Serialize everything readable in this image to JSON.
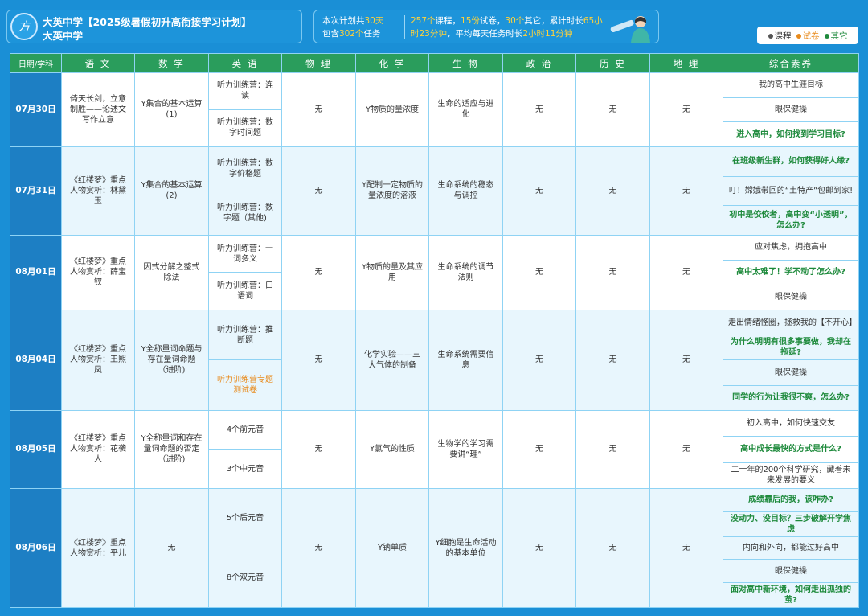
{
  "header": {
    "logo_glyph": "方",
    "title": "大英中学【2025级暑假初升高衔接学习计划】",
    "subtitle": "大英中学",
    "stats": {
      "plan_prefix": "本次计划共",
      "plan_days": "30天",
      "tasks_prefix": "包含",
      "tasks_count": "302个",
      "tasks_suffix": "任务",
      "courses": "257个",
      "courses_suffix": "课程，",
      "papers": "15份",
      "papers_suffix": "试卷，",
      "others": "30个",
      "others_suffix": "其它，累计时长",
      "total_time": "65小时23分钟",
      "avg_prefix": "，平均每天任务时长",
      "avg_time": "2小时11分钟"
    },
    "legend": [
      {
        "label": "课程",
        "color": "#555555"
      },
      {
        "label": "试卷",
        "color": "#e88a1a"
      },
      {
        "label": "其它",
        "color": "#1e8a3c"
      }
    ]
  },
  "columns": [
    "日期/学科",
    "语 文",
    "数 学",
    "英 语",
    "物 理",
    "化 学",
    "生 物",
    "政 治",
    "历 史",
    "地 理",
    "综合素养"
  ],
  "days": [
    {
      "date": "07月30日",
      "chinese": "倚天长剑，立意制胜——论述文写作立意",
      "math": "Y集合的基本运算(1)",
      "english": [
        {
          "text": "听力训练营：连读",
          "type": "course"
        },
        {
          "text": "听力训练营：数字时间题",
          "type": "course"
        }
      ],
      "physics": "无",
      "chemistry": "Y物质的量浓度",
      "biology": "生命的适应与进化",
      "politics": "无",
      "history": "无",
      "geography": "无",
      "quality": [
        {
          "text": "我的高中生涯目标",
          "type": "course"
        },
        {
          "text": "眼保健操",
          "type": "course"
        },
        {
          "text": "进入高中，如何找到学习目标?",
          "type": "other"
        }
      ]
    },
    {
      "date": "07月31日",
      "chinese": "《红楼梦》重点人物赏析：林黛玉",
      "math": "Y集合的基本运算(2)",
      "english": [
        {
          "text": "听力训练营：数字价格题",
          "type": "course"
        },
        {
          "text": "听力训练营：数字题（其他)",
          "type": "course"
        }
      ],
      "physics": "无",
      "chemistry": "Y配制一定物质的量浓度的溶液",
      "biology": "生命系统的稳态与调控",
      "politics": "无",
      "history": "无",
      "geography": "无",
      "quality": [
        {
          "text": "在班级新生群，如何获得好人缘?",
          "type": "other"
        },
        {
          "text": "叮！嫦娥带回的“土特产”包邮到家!",
          "type": "course"
        },
        {
          "text": "初中是佼佼者，高中变“小透明”，怎么办?",
          "type": "other"
        }
      ]
    },
    {
      "date": "08月01日",
      "chinese": "《红楼梦》重点人物赏析：薛宝钗",
      "math": "因式分解之整式除法",
      "english": [
        {
          "text": "听力训练营：一词多义",
          "type": "course"
        },
        {
          "text": "听力训练营：口语词",
          "type": "course"
        }
      ],
      "physics": "无",
      "chemistry": "Y物质的量及其应用",
      "biology": "生命系统的调节法则",
      "politics": "无",
      "history": "无",
      "geography": "无",
      "quality": [
        {
          "text": "应对焦虑，拥抱高中",
          "type": "course"
        },
        {
          "text": "高中太难了！学不动了怎么办?",
          "type": "other"
        },
        {
          "text": "眼保健操",
          "type": "course"
        }
      ]
    },
    {
      "date": "08月04日",
      "chinese": "《红楼梦》重点人物赏析：王熙凤",
      "math": "Y全称量词命题与存在量词命题（进阶)",
      "english": [
        {
          "text": "听力训练营：推断题",
          "type": "course"
        },
        {
          "text": "听力训练营专题测试卷",
          "type": "paper"
        }
      ],
      "physics": "无",
      "chemistry": "化学实验——三大气体的制备",
      "biology": "生命系统需要信息",
      "politics": "无",
      "history": "无",
      "geography": "无",
      "quality": [
        {
          "text": "走出情绪怪圈，拯救我的【不开心】",
          "type": "course"
        },
        {
          "text": "为什么明明有很多事要做，我却在拖延?",
          "type": "other"
        },
        {
          "text": "眼保健操",
          "type": "course"
        },
        {
          "text": "同学的行为让我很不爽，怎么办?",
          "type": "other"
        }
      ]
    },
    {
      "date": "08月05日",
      "chinese": "《红楼梦》重点人物赏析：花袭人",
      "math": "Y全称量词和存在量词命题的否定（进阶)",
      "english": [
        {
          "text": "4个前元音",
          "type": "course"
        },
        {
          "text": "3个中元音",
          "type": "course"
        }
      ],
      "physics": "无",
      "chemistry": "Y氯气的性质",
      "biology": "生物学的学习需要讲“理”",
      "politics": "无",
      "history": "无",
      "geography": "无",
      "quality": [
        {
          "text": "初入高中，如何快速交友",
          "type": "course"
        },
        {
          "text": "高中成长最快的方式是什么?",
          "type": "other"
        },
        {
          "text": "二十年的200个科学研究，藏着未来发展的要义",
          "type": "course"
        }
      ]
    },
    {
      "date": "08月06日",
      "chinese": "《红楼梦》重点人物赏析：平儿",
      "math": "无",
      "english": [
        {
          "text": "5个后元音",
          "type": "course"
        },
        {
          "text": "8个双元音",
          "type": "course"
        }
      ],
      "physics": "无",
      "chemistry": "Y钠单质",
      "biology": "Y细胞是生命活动的基本单位",
      "politics": "无",
      "history": "无",
      "geography": "无",
      "quality": [
        {
          "text": "成绩靠后的我，该咋办?",
          "type": "other"
        },
        {
          "text": "没动力、没目标？三步破解开学焦虑",
          "type": "other"
        },
        {
          "text": "内向和外向，都能过好高中",
          "type": "course"
        },
        {
          "text": "眼保健操",
          "type": "course"
        },
        {
          "text": "面对高中新环境，如何走出孤独的茧?",
          "type": "other"
        }
      ]
    }
  ]
}
